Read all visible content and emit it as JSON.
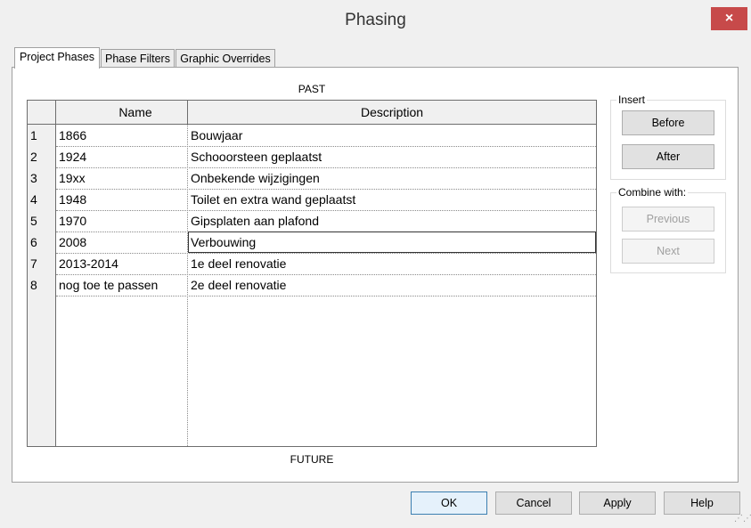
{
  "window": {
    "title": "Phasing",
    "close_icon": "×"
  },
  "tabs": [
    "Project Phases",
    "Phase Filters",
    "Graphic Overrides"
  ],
  "labels": {
    "past": "PAST",
    "future": "FUTURE"
  },
  "table": {
    "columns": [
      "Name",
      "Description"
    ],
    "rows": [
      {
        "num": "1",
        "name": "1866",
        "description": "Bouwjaar"
      },
      {
        "num": "2",
        "name": "1924",
        "description": "Schooorsteen geplaatst"
      },
      {
        "num": "3",
        "name": "19xx",
        "description": "Onbekende wijzigingen"
      },
      {
        "num": "4",
        "name": "1948",
        "description": "Toilet en extra wand geplaatst"
      },
      {
        "num": "5",
        "name": "1970",
        "description": "Gipsplaten aan plafond"
      },
      {
        "num": "6",
        "name": "2008",
        "description": "Verbouwing"
      },
      {
        "num": "7",
        "name": "2013-2014",
        "description": "1e deel renovatie"
      },
      {
        "num": "8",
        "name": "nog toe te passen",
        "description": "2e deel renovatie"
      }
    ]
  },
  "insert_group": {
    "label": "Insert",
    "before": "Before",
    "after": "After"
  },
  "combine_group": {
    "label": "Combine with:",
    "previous": "Previous",
    "next": "Next"
  },
  "footer": {
    "ok": "OK",
    "cancel": "Cancel",
    "apply": "Apply",
    "help": "Help"
  }
}
